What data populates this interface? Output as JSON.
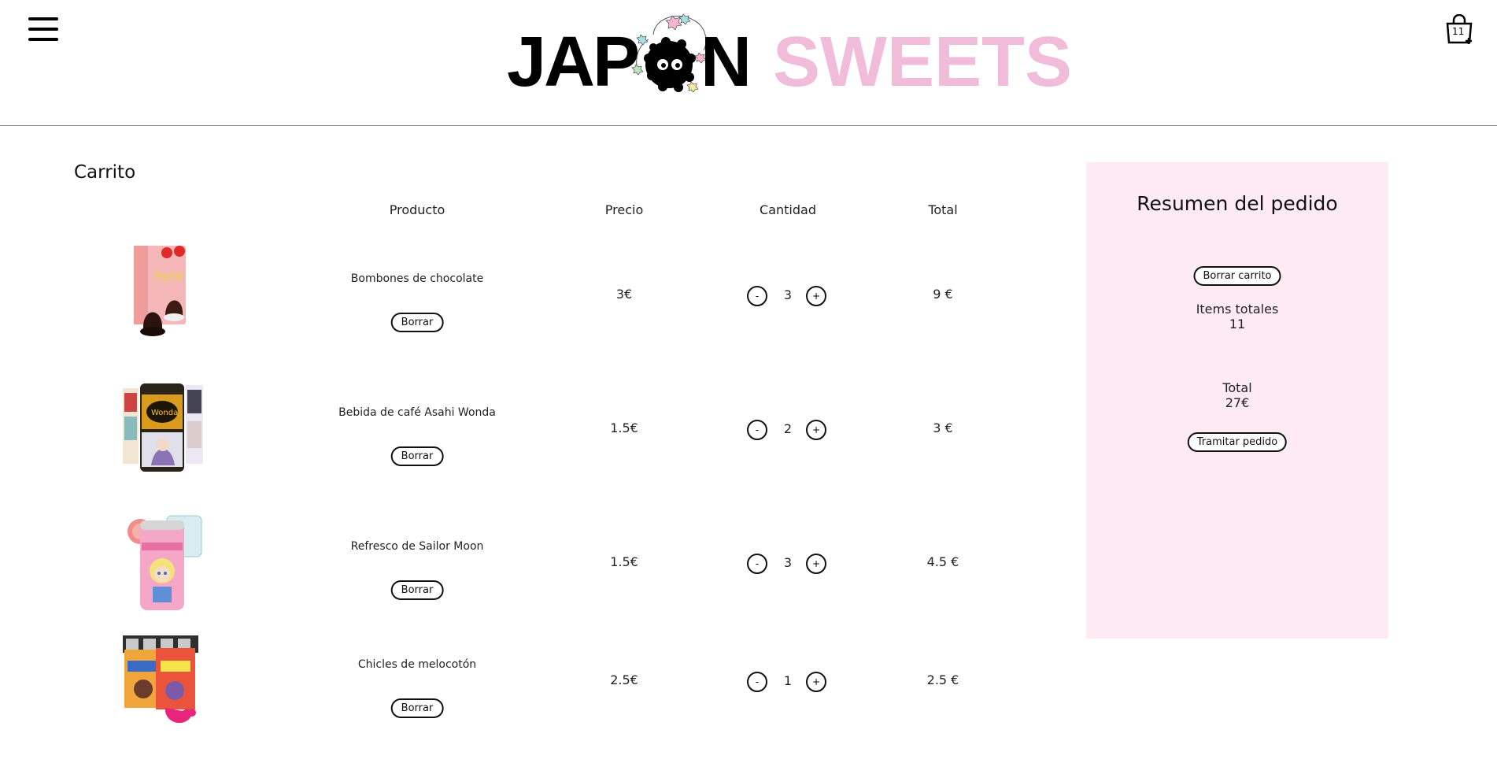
{
  "header": {
    "logo_part1": "JAP",
    "logo_part2": "N",
    "logo_part3": "SWEETS",
    "cart_count": "11"
  },
  "colors": {
    "accent_pink": "#f0bcd9",
    "summary_bg": "#fdeaf3"
  },
  "cart": {
    "title": "Carrito",
    "columns": {
      "product": "Producto",
      "price": "Precio",
      "quantity": "Cantidad",
      "total": "Total"
    },
    "minus_label": "-",
    "plus_label": "+",
    "items": [
      {
        "name": "Bombones de chocolate",
        "delete_label": "Borrar",
        "price": "3€",
        "qty": "3",
        "total": "9 €",
        "image": "chocolate-box-image"
      },
      {
        "name": "Bebida de café Asahi Wonda",
        "delete_label": "Borrar",
        "price": "1.5€",
        "qty": "2",
        "total": "3 €",
        "image": "coffee-can-image"
      },
      {
        "name": "Refresco de Sailor Moon",
        "delete_label": "Borrar",
        "price": "1.5€",
        "qty": "3",
        "total": "4.5 €",
        "image": "soda-can-image"
      },
      {
        "name": "Chicles de melocotón",
        "delete_label": "Borrar",
        "price": "2.5€",
        "qty": "1",
        "total": "2.5 €",
        "image": "gum-pack-image"
      }
    ]
  },
  "summary": {
    "title": "Resumen del pedido",
    "clear_label": "Borrar carrito",
    "items_label": "Items totales",
    "items_value": "11",
    "total_label": "Total",
    "total_value": "27€",
    "checkout_label": "Tramitar pedido"
  }
}
